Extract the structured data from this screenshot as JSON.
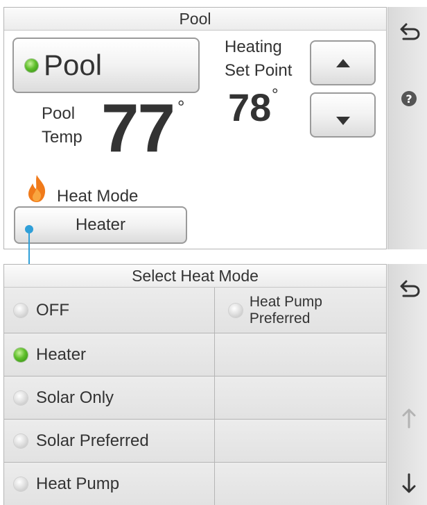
{
  "top_panel": {
    "title": "Pool",
    "pool_button": {
      "label": "Pool",
      "led": "on"
    },
    "pool_temp": {
      "label_line1": "Pool",
      "label_line2": "Temp",
      "value": "77",
      "unit": "°"
    },
    "set_point": {
      "label_line1": "Heating",
      "label_line2": "Set Point",
      "value": "78",
      "unit": "°"
    },
    "heat_mode": {
      "label": "Heat Mode",
      "value": "Heater"
    }
  },
  "bottom_panel": {
    "title": "Select Heat Mode",
    "options_left": [
      {
        "label": "OFF",
        "selected": false
      },
      {
        "label": "Heater",
        "selected": true
      },
      {
        "label": "Solar Only",
        "selected": false
      },
      {
        "label": "Solar Preferred",
        "selected": false
      },
      {
        "label": "Heat Pump",
        "selected": false
      }
    ],
    "options_right": [
      {
        "label": "Heat Pump Preferred",
        "selected": false
      }
    ]
  },
  "icons": {
    "back": "back-arrow-icon",
    "help": "help-icon",
    "up": "up-arrow-icon",
    "down": "down-arrow-icon",
    "flame": "flame-icon"
  },
  "colors": {
    "accent": "#2f9fd8",
    "led_on": "#5fbf2b",
    "flame": "#f07a1a"
  }
}
